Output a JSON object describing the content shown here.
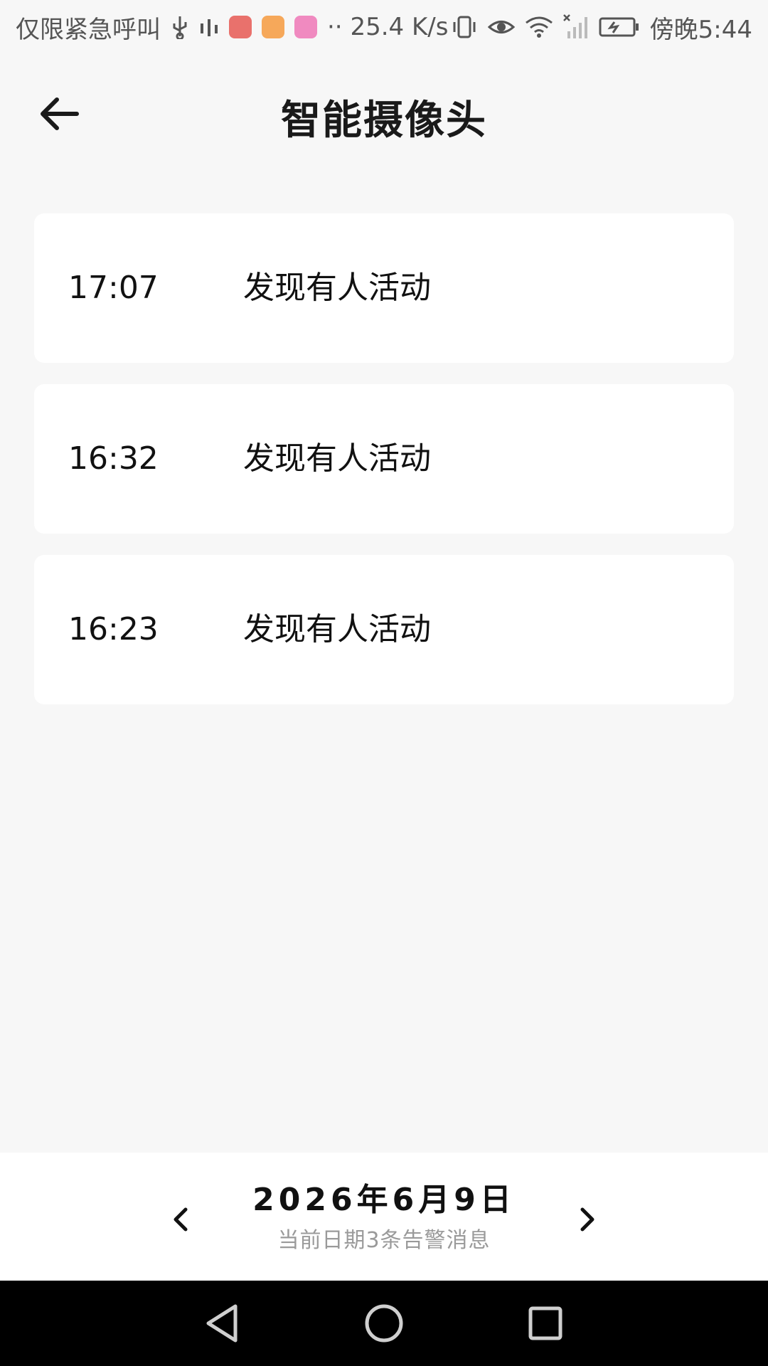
{
  "status_bar": {
    "carrier_text": "仅限紧急呼叫",
    "speed": "25.4 K/s",
    "time": "傍晚5:44",
    "app_icons": [
      "#e9716c",
      "#f6a85a",
      "#f08ac0"
    ]
  },
  "header": {
    "title": "智能摄像头"
  },
  "alarms": [
    {
      "time": "17:07",
      "message": "发现有人活动"
    },
    {
      "time": "16:32",
      "message": "发现有人活动"
    },
    {
      "time": "16:23",
      "message": "发现有人活动"
    }
  ],
  "date_bar": {
    "date": "2026年6月9日",
    "summary": "当前日期3条告警消息"
  },
  "colors": {
    "background": "#f7f7f7",
    "card": "#ffffff",
    "secondary_text": "#9a9a9a"
  }
}
